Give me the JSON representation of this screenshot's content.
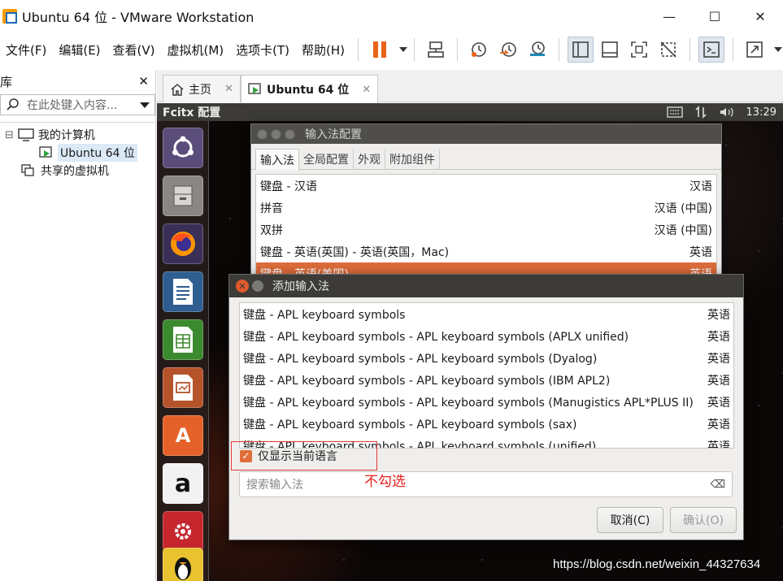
{
  "window": {
    "title": "Ubuntu 64 位 - VMware Workstation",
    "controls": {
      "minimize": "—",
      "maximize": "☐",
      "close": "✕"
    }
  },
  "menu": [
    {
      "label": "文件(F)"
    },
    {
      "label": "编辑(E)"
    },
    {
      "label": "查看(V)"
    },
    {
      "label": "虚拟机(M)"
    },
    {
      "label": "选项卡(T)"
    },
    {
      "label": "帮助(H)"
    }
  ],
  "toolbar_icons": [
    "pause-icon",
    "send-ctrl-alt-del-icon",
    "snapshot-icon",
    "revert-snapshot-icon",
    "snapshot-manager-icon",
    "library-view-icon",
    "console-view-icon",
    "fullscreen-icon",
    "unity-icon",
    "terminal-icon",
    "stretch-icon"
  ],
  "library": {
    "title": "库",
    "close": "✕",
    "search_placeholder": "在此处键入内容...",
    "items": [
      {
        "label": "我的计算机",
        "toggle": "⊟"
      },
      {
        "label": "Ubuntu 64 位"
      },
      {
        "label": "共享的虚拟机"
      }
    ]
  },
  "tabs": [
    {
      "label": "主页",
      "close": "✕"
    },
    {
      "label": "Ubuntu 64 位",
      "close": "✕"
    }
  ],
  "ubuntu": {
    "panel_title": "Fcitx 配置",
    "time": "13:29",
    "launcher": [
      "ubuntu-dash-icon",
      "files-icon",
      "firefox-icon",
      "writer-icon",
      "calc-icon",
      "impress-icon",
      "software-center-icon",
      "amazon-icon",
      "settings-icon",
      "qq-penguin-icon",
      "terminal-icon"
    ],
    "launcher_glyphs": {
      "amazon": "a",
      "software": "A",
      "terminal": ">_"
    }
  },
  "config_window": {
    "title": "输入法配置",
    "tabs": [
      "输入法",
      "全局配置",
      "外观",
      "附加组件"
    ],
    "rows": [
      {
        "name": "键盘 - 汉语",
        "lang": "汉语"
      },
      {
        "name": "拼音",
        "lang": "汉语 (中国)"
      },
      {
        "name": "双拼",
        "lang": "汉语 (中国)"
      },
      {
        "name": "键盘 - 英语(英国) - 英语(英国，Mac)",
        "lang": "英语"
      },
      {
        "name": "键盘 - 英语(美国)",
        "lang": "英语"
      }
    ]
  },
  "add_dialog": {
    "title": "添加输入法",
    "rows": [
      {
        "name": "键盘 - APL keyboard symbols",
        "lang": "英语"
      },
      {
        "name": "键盘 - APL keyboard symbols - APL keyboard symbols (APLX unified)",
        "lang": "英语"
      },
      {
        "name": "键盘 - APL keyboard symbols - APL keyboard symbols (Dyalog)",
        "lang": "英语"
      },
      {
        "name": "键盘 - APL keyboard symbols - APL keyboard symbols (IBM APL2)",
        "lang": "英语"
      },
      {
        "name": "键盘 - APL keyboard symbols - APL keyboard symbols (Manugistics APL*PLUS II)",
        "lang": "英语"
      },
      {
        "name": "键盘 - APL keyboard symbols - APL keyboard symbols (sax)",
        "lang": "英语"
      },
      {
        "name": "键盘 - APL keyboard symbols - APL keyboard symbols (unified)",
        "lang": "英语"
      }
    ],
    "only_current_language": {
      "label": "仅显示当前语言",
      "checked": true
    },
    "annotation": "不勾选",
    "search_placeholder": "搜索输入法",
    "cancel": "取消(C)",
    "ok": "确认(O)"
  },
  "watermark": "https://blog.csdn.net/weixin_44327634",
  "colors": {
    "accent_orange": "#e06d3a",
    "annotation_red": "#e8211f",
    "pause_orange": "#e8641a"
  }
}
